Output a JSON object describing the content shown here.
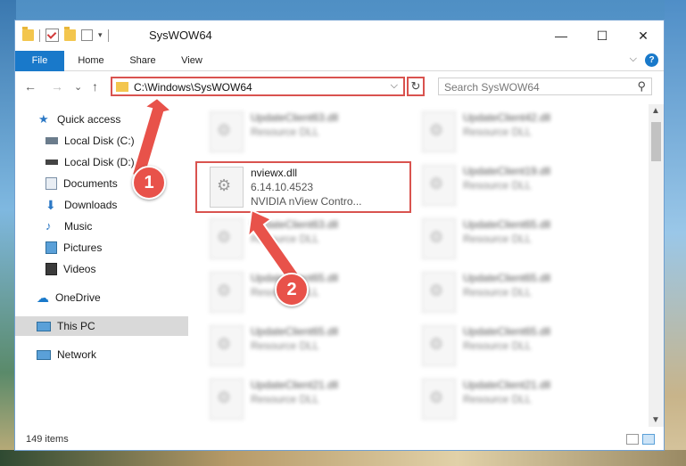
{
  "titlebar": {
    "title": "SysWOW64",
    "min": "—",
    "max": "☐",
    "close": "✕"
  },
  "ribbon": {
    "file": "File",
    "home": "Home",
    "share": "Share",
    "view": "View",
    "chevron": "⌵",
    "help": "?"
  },
  "nav": {
    "back": "←",
    "forward": "→",
    "recent": "⌄",
    "up": "↑",
    "address": "C:\\Windows\\SysWOW64",
    "address_dd": "⌵",
    "refresh": "↻",
    "search_placeholder": "Search SysWOW64",
    "search_icon": "search-icon"
  },
  "sidebar": {
    "items": [
      {
        "label": "Quick access",
        "icon": "star-icon"
      },
      {
        "label": "Local Disk (C:)",
        "icon": "drive-icon",
        "pinned": true
      },
      {
        "label": "Local Disk (D:)",
        "icon": "drive-icon",
        "pinned": true
      },
      {
        "label": "Documents",
        "icon": "documents-icon",
        "pinned": true
      },
      {
        "label": "Downloads",
        "icon": "download-icon",
        "pinned": true
      },
      {
        "label": "Music",
        "icon": "music-icon",
        "pinned": true
      },
      {
        "label": "Pictures",
        "icon": "pictures-icon",
        "pinned": true
      },
      {
        "label": "Videos",
        "icon": "videos-icon",
        "pinned": true
      },
      {
        "label": "OneDrive",
        "icon": "cloud-icon"
      },
      {
        "label": "This PC",
        "icon": "pc-icon",
        "selected": true
      },
      {
        "label": "Network",
        "icon": "network-icon"
      }
    ]
  },
  "files": {
    "left": [
      {
        "name": "UpdateClient63.dll",
        "type": "Resource DLL"
      },
      {
        "name": "nviewx.dll",
        "version": "6.14.10.4523",
        "desc": "NVIDIA nView Contro..."
      },
      {
        "name": "UpdateClient63.dll",
        "type": "Resource DLL"
      },
      {
        "name": "UpdateClient65.dll",
        "type": "Resource DLL"
      },
      {
        "name": "UpdateClient65.dll",
        "type": "Resource DLL"
      },
      {
        "name": "UpdateClient21.dll",
        "type": "Resource DLL"
      }
    ],
    "right": [
      {
        "name": "UpdateClient42.dll",
        "type": "Resource DLL"
      },
      {
        "name": "UpdateClient19.dll",
        "type": "Resource DLL"
      },
      {
        "name": "UpdateClient65.dll",
        "type": "Resource DLL"
      },
      {
        "name": "UpdateClient65.dll",
        "type": "Resource DLL"
      },
      {
        "name": "UpdateClient65.dll",
        "type": "Resource DLL"
      },
      {
        "name": "UpdateClient21.dll",
        "type": "Resource DLL"
      }
    ]
  },
  "status": {
    "count": "149 items"
  },
  "annotations": {
    "step1": "1",
    "step2": "2",
    "accent": "#e8524a"
  }
}
